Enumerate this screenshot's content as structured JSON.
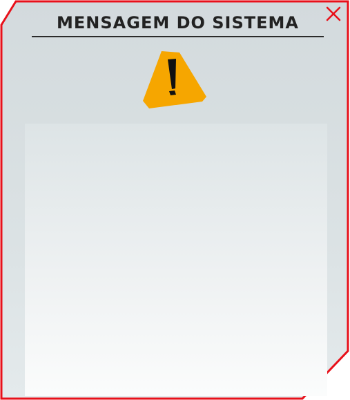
{
  "dialog": {
    "title": "MENSAGEM DO SISTEMA",
    "close_icon": "close-icon",
    "alert_icon": "warning-icon",
    "message": ""
  },
  "colors": {
    "border": "#e8101a",
    "panel": "#d3dadd",
    "title_text": "#222222",
    "warning_fill": "#f6a600",
    "warning_mark": "#111111"
  }
}
